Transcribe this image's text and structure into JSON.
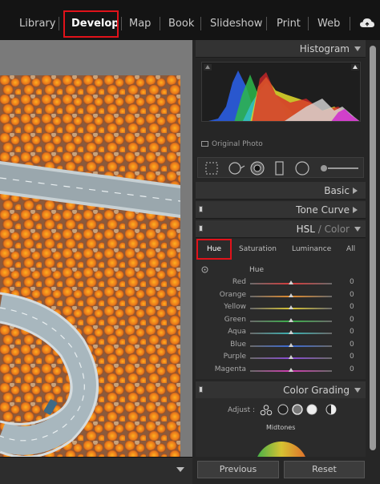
{
  "modules": [
    "Library",
    "Develop",
    "Map",
    "Book",
    "Slideshow",
    "Print",
    "Web"
  ],
  "active_module": "Develop",
  "panels": {
    "histogram": "Histogram",
    "original_photo": "Original Photo",
    "basic": "Basic",
    "tone_curve": "Tone Curve",
    "hsl_title": "HSL",
    "hsl_slash": " / ",
    "color": "Color",
    "color_grading": "Color Grading"
  },
  "hsl": {
    "tabs": [
      "Hue",
      "Saturation",
      "Luminance",
      "All"
    ],
    "active_tab": "Hue",
    "section_label": "Hue",
    "rows": [
      {
        "label": "Red",
        "value": "0",
        "color": "#d63a3a"
      },
      {
        "label": "Orange",
        "value": "0",
        "color": "#e08a2c"
      },
      {
        "label": "Yellow",
        "value": "0",
        "color": "#d6c232"
      },
      {
        "label": "Green",
        "value": "0",
        "color": "#3ab04a"
      },
      {
        "label": "Aqua",
        "value": "0",
        "color": "#3ab0b0"
      },
      {
        "label": "Blue",
        "value": "0",
        "color": "#3a6ad6"
      },
      {
        "label": "Purple",
        "value": "0",
        "color": "#8a4ad6"
      },
      {
        "label": "Magenta",
        "value": "0",
        "color": "#d03ab0"
      }
    ]
  },
  "color_grading": {
    "adjust_label": "Adjust :",
    "midtones_label": "Midtones"
  },
  "buttons": {
    "previous": "Previous",
    "reset": "Reset"
  },
  "highlight_color": "#e1121a"
}
